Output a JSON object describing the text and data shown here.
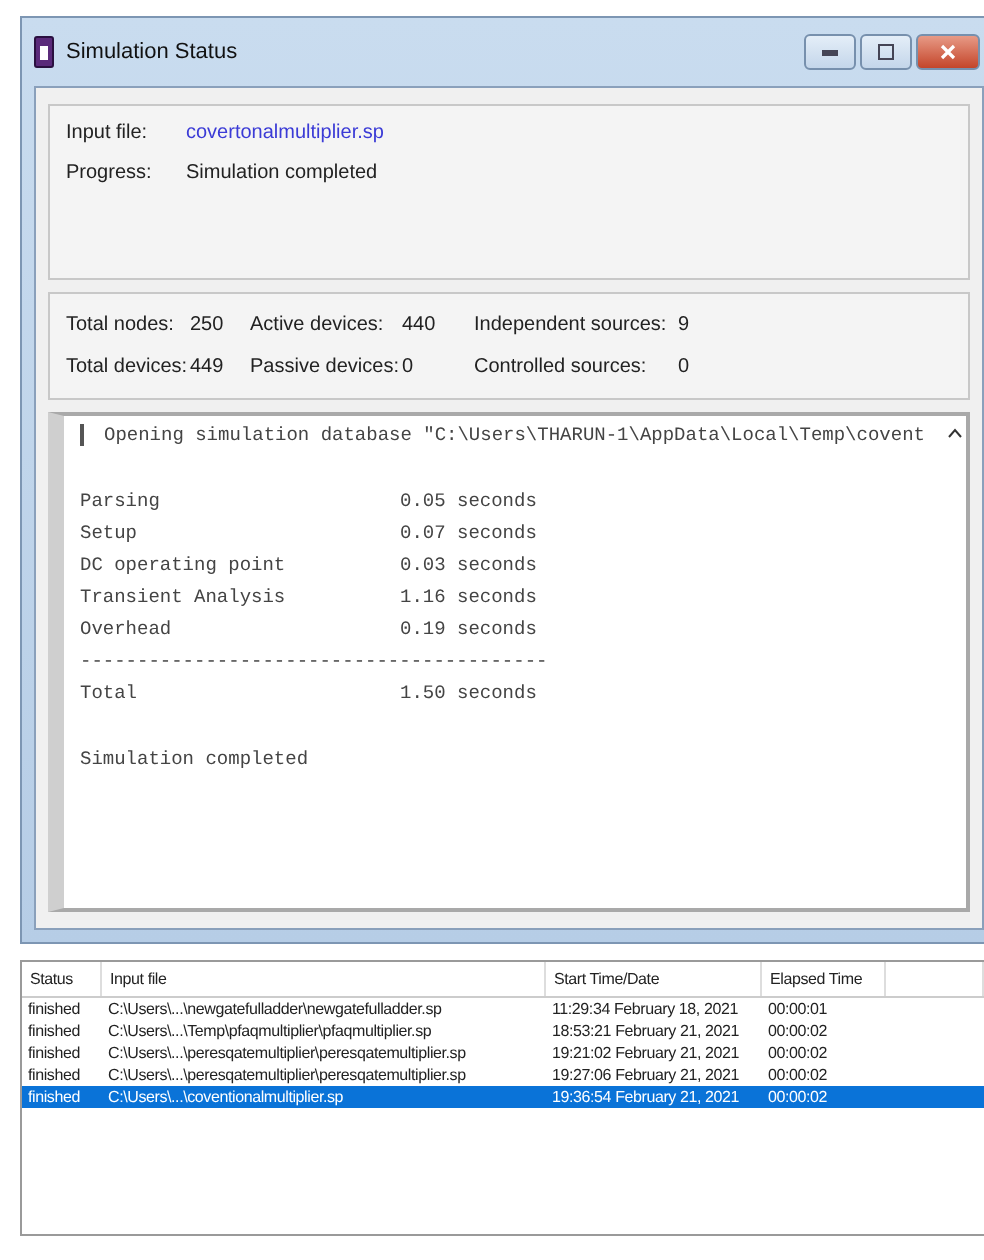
{
  "window": {
    "title": "Simulation Status"
  },
  "info": {
    "input_file_label": "Input file:",
    "input_file": "covertonalmultiplier.sp",
    "progress_label": "Progress:",
    "progress": "Simulation completed"
  },
  "stats": [
    {
      "label": "Total nodes:",
      "value": "250"
    },
    {
      "label": "Active devices:",
      "value": "440"
    },
    {
      "label": "Independent sources:",
      "value": "9"
    },
    {
      "label": "Total devices:",
      "value": "449"
    },
    {
      "label": "Passive devices:",
      "value": "0"
    },
    {
      "label": "Controlled sources:",
      "value": "0"
    }
  ],
  "log": [
    {
      "kind": "header",
      "text": "Opening simulation database \"C:\\Users\\THARUN-1\\AppData\\Local\\Temp\\covent"
    },
    {
      "kind": "blank"
    },
    {
      "kind": "timing",
      "label": "Parsing",
      "value": "0.05 seconds"
    },
    {
      "kind": "timing",
      "label": "Setup",
      "value": "0.07 seconds"
    },
    {
      "kind": "timing",
      "label": "DC operating point",
      "value": "0.03 seconds"
    },
    {
      "kind": "timing",
      "label": "Transient Analysis",
      "value": "1.16 seconds"
    },
    {
      "kind": "timing",
      "label": "Overhead",
      "value": "0.19 seconds"
    },
    {
      "kind": "text",
      "text": "-----------------------------------------"
    },
    {
      "kind": "timing",
      "label": "Total",
      "value": "1.50 seconds"
    },
    {
      "kind": "blank"
    },
    {
      "kind": "text",
      "text": "Simulation completed"
    }
  ],
  "table": {
    "columns": [
      "Status",
      "Input file",
      "Start Time/Date",
      "Elapsed Time"
    ],
    "rows": [
      {
        "selected": false,
        "cells": [
          "finished",
          "C:\\Users\\...\\newgatefulladder\\newgatefulladder.sp",
          "11:29:34 February 18, 2021",
          "00:00:01"
        ]
      },
      {
        "selected": false,
        "cells": [
          "finished",
          "C:\\Users\\...\\Temp\\pfaqmultiplier\\pfaqmultiplier.sp",
          "18:53:21 February 21, 2021",
          "00:00:02"
        ]
      },
      {
        "selected": false,
        "cells": [
          "finished",
          "C:\\Users\\...\\peresqatemultiplier\\peresqatemultiplier.sp",
          "19:21:02 February 21, 2021",
          "00:00:02"
        ]
      },
      {
        "selected": false,
        "cells": [
          "finished",
          "C:\\Users\\...\\peresqatemultiplier\\peresqatemultiplier.sp",
          "19:27:06 February 21, 2021",
          "00:00:02"
        ]
      },
      {
        "selected": true,
        "cells": [
          "finished",
          "C:\\Users\\...\\coventionalmultiplier.sp",
          "19:36:54 February 21, 2021",
          "00:00:02"
        ]
      }
    ]
  }
}
